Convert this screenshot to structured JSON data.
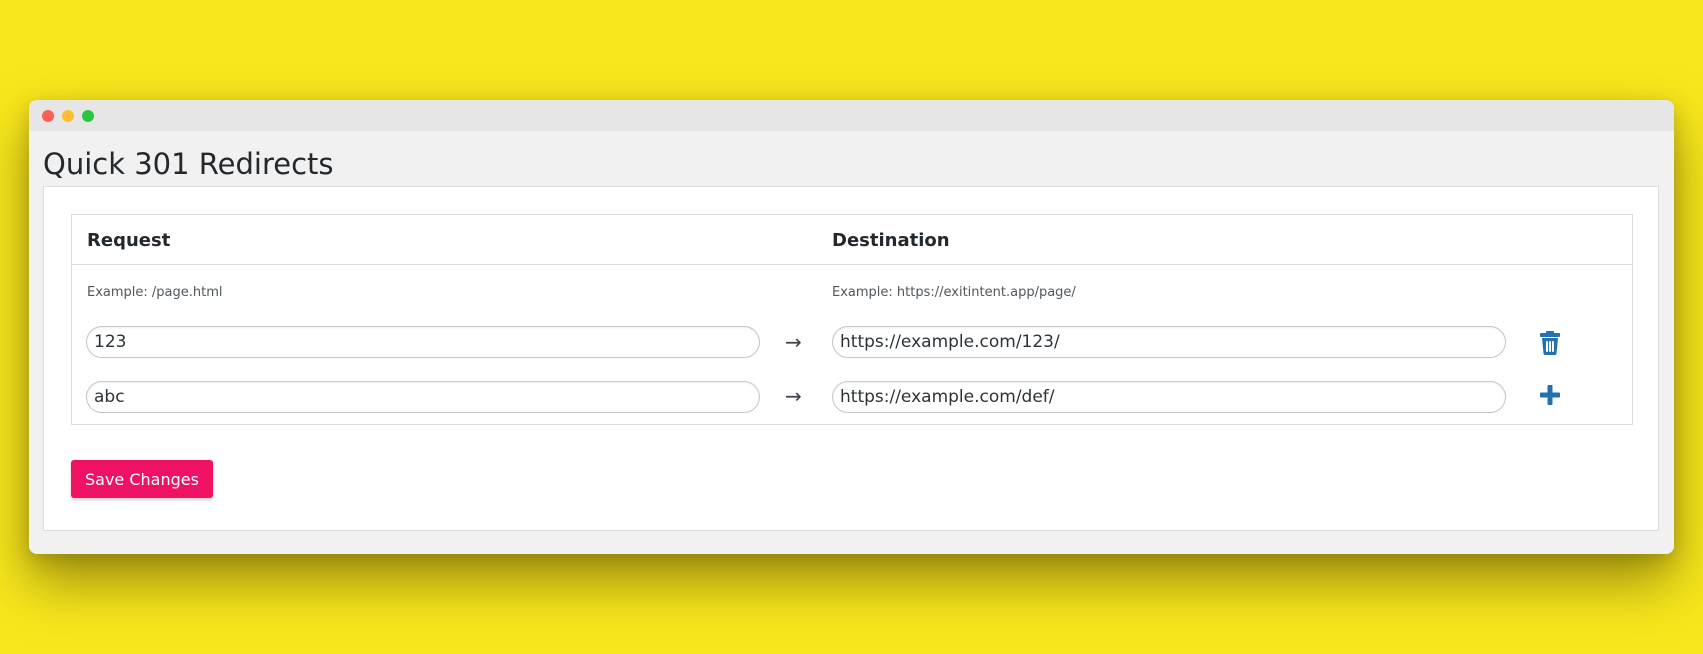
{
  "page": {
    "title": "Quick 301 Redirects"
  },
  "table": {
    "headers": {
      "request": "Request",
      "destination": "Destination"
    },
    "hints": {
      "request": "Example: /page.html",
      "destination": "Example: https://exitintent.app/page/"
    },
    "arrow": "→",
    "rows": [
      {
        "request": "123",
        "destination": "https://example.com/123/",
        "action_icon": "trash-icon"
      },
      {
        "request": "abc",
        "destination": "https://example.com/def/",
        "action_icon": "plus-icon"
      }
    ]
  },
  "actions": {
    "save_label": "Save Changes"
  },
  "colors": {
    "background": "#f8e71c",
    "accent": "#ee1164",
    "icon": "#2271b1"
  }
}
